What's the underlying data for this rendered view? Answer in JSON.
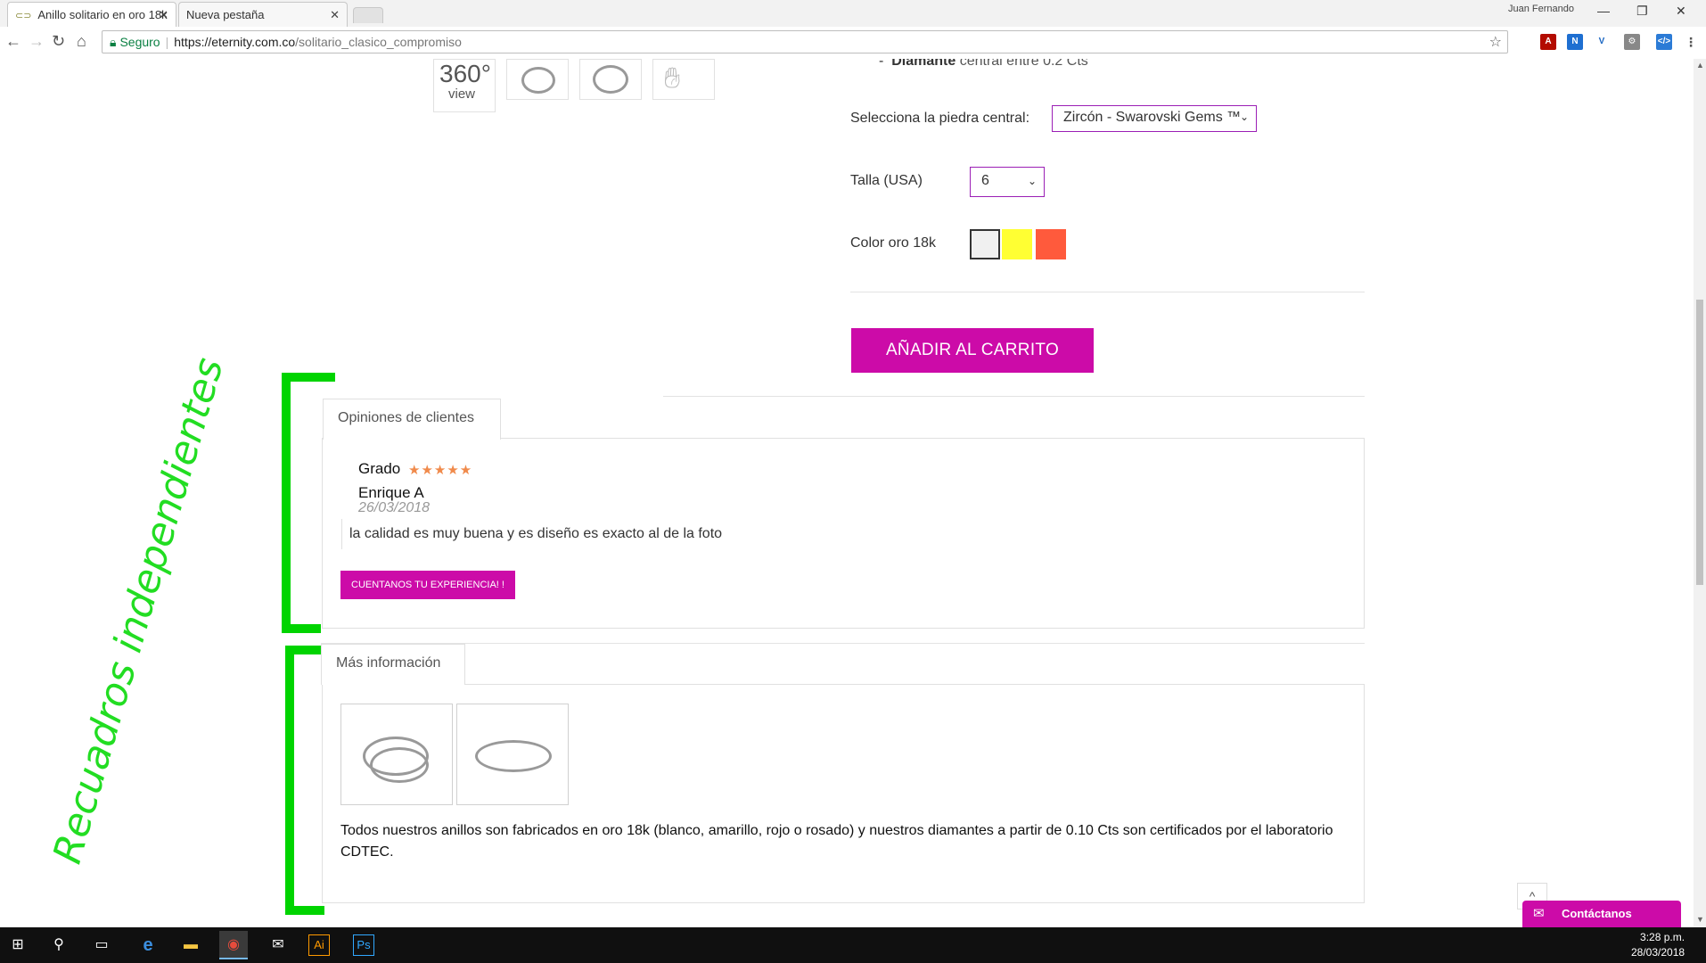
{
  "browser": {
    "tabs": [
      {
        "title": "Anillo solitario en oro 18k",
        "active": true
      },
      {
        "title": "Nueva pestaña",
        "active": false
      }
    ],
    "user": "Juan Fernando",
    "url": {
      "secure_label": "Seguro",
      "scheme_host": "https://eternity.com.co",
      "path": "/solitario_clasico_compromiso"
    }
  },
  "gallery": {
    "view360_big": "360°",
    "view360_small": "view"
  },
  "product": {
    "diamond_bullet_label": "Diamante",
    "diamond_bullet_text": "central entre 0.2 Cts",
    "stone_label": "Selecciona la piedra central:",
    "stone_value": "Zircón - Swarovski Gems ™",
    "size_label": "Talla (USA)",
    "size_value": "6",
    "color_label": "Color oro 18k",
    "colors": [
      "#f0f0f0",
      "#ffff33",
      "#ff5a3c"
    ],
    "add_to_cart": "AÑADIR AL CARRITO"
  },
  "reviews": {
    "tab_label": "Opiniones de clientes",
    "grade_label": "Grado",
    "stars": "★★★★★",
    "rating": 5,
    "author": "Enrique A",
    "date": "26/03/2018",
    "comment": "la calidad es muy buena y es diseño es exacto al de la foto",
    "cta": "CUENTANOS TU EXPERIENCIA! !"
  },
  "more_info": {
    "tab_label": "Más información",
    "text": "Todos nuestros anillos son fabricados en oro 18k (blanco, amarillo, rojo o rosado) y nuestros diamantes a partir de 0.10 Cts son certificados por el laboratorio CDTEC."
  },
  "annotation": "Recuadros independientes",
  "chat": {
    "label": "Contáctanos",
    "scroll_up": "^"
  },
  "taskbar": {
    "time": "3:28 p.m.",
    "date": "28/03/2018"
  },
  "colors": {
    "accent": "#cc0ba8",
    "annotation": "#00d400"
  }
}
